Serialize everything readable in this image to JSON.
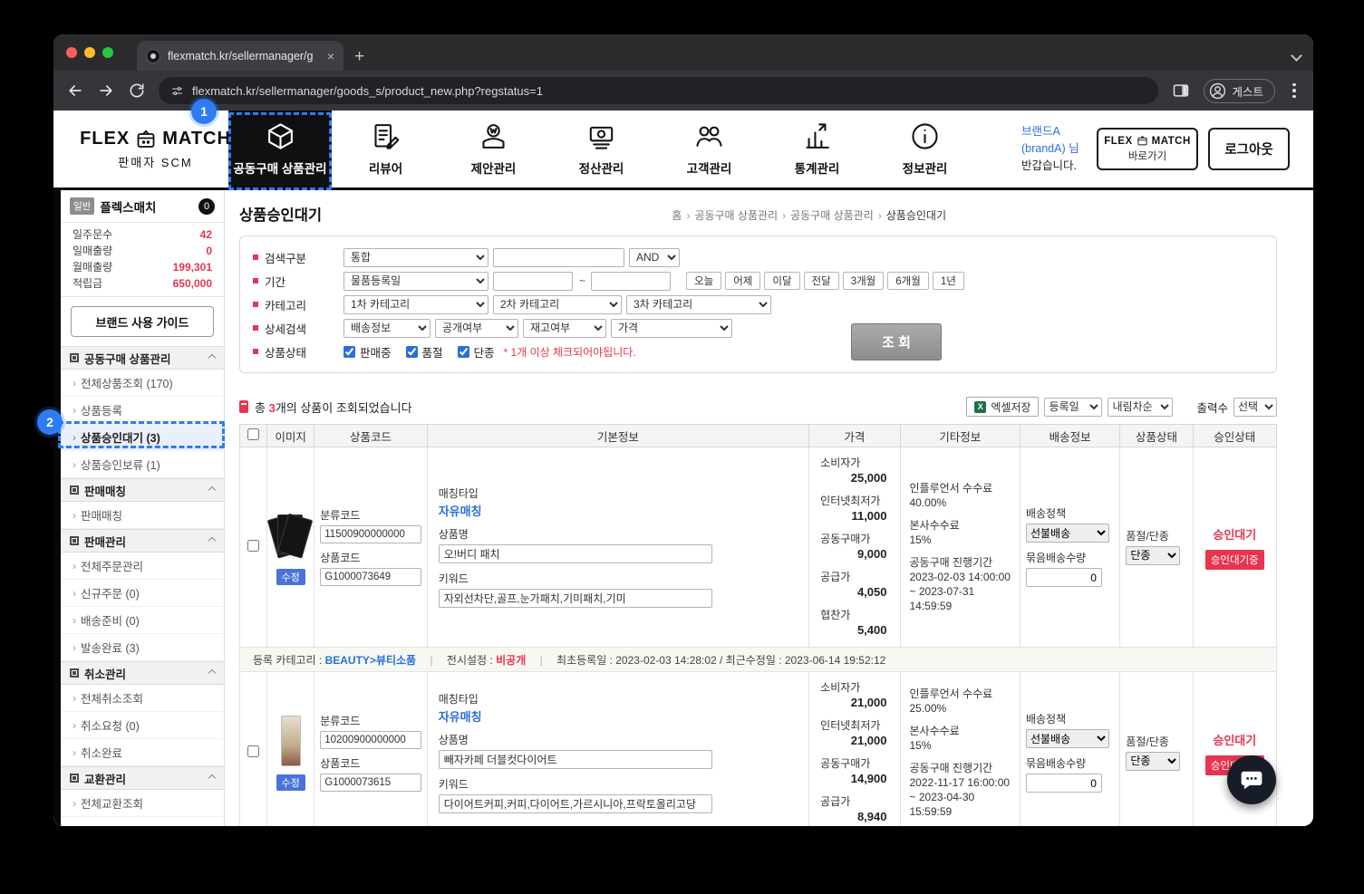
{
  "colors": {
    "accent_blue": "#2e7bf6",
    "danger_red": "#e8354f",
    "link_blue": "#2a6fdb"
  },
  "icons": {
    "close_tab": "×",
    "new_tab": "+"
  },
  "browser": {
    "tab_title": "flexmatch.kr/sellermanager/g",
    "url": "flexmatch.kr/sellermanager/goods_s/product_new.php?regstatus=1",
    "profile_label": "게스트"
  },
  "header": {
    "logo_flex": "FLEX",
    "logo_match": "MATCH",
    "logo_sub": "판매자 SCM",
    "nav": [
      {
        "label": "공동구매 상품관리"
      },
      {
        "label": "리뷰어"
      },
      {
        "label": "제안관리"
      },
      {
        "label": "정산관리"
      },
      {
        "label": "고객관리"
      },
      {
        "label": "통계관리"
      },
      {
        "label": "정보관리"
      }
    ],
    "welcome_brand": "브랜드A",
    "welcome_account": "(brandA) 님",
    "welcome_greeting": "반갑습니다.",
    "shortcut_flex": "FLEX",
    "shortcut_match": "MATCH",
    "shortcut_sub": "바로가기",
    "logout": "로그아웃"
  },
  "callouts": {
    "step1": "1",
    "step2": "2"
  },
  "sidebar": {
    "plan_badge": "일반",
    "brand_name": "플렉스매치",
    "alert_count": "0",
    "stats": [
      {
        "label": "일주문수",
        "value": "42"
      },
      {
        "label": "일매출량",
        "value": "0"
      },
      {
        "label": "월매출량",
        "value": "199,301"
      },
      {
        "label": "적립금",
        "value": "650,000"
      }
    ],
    "guide_button": "브랜드 사용 가이드",
    "sections": [
      {
        "title": "공동구매 상품관리",
        "items": [
          {
            "label": "전체상품조회 (170)"
          },
          {
            "label": "상품등록"
          },
          {
            "label": "상품승인대기 (3)"
          },
          {
            "label": "상품승인보류 (1)"
          }
        ]
      },
      {
        "title": "판매매칭",
        "items": [
          {
            "label": "판매매칭"
          }
        ]
      },
      {
        "title": "판매관리",
        "items": [
          {
            "label": "전체주문관리"
          },
          {
            "label": "신규주문 (0)"
          },
          {
            "label": "배송준비 (0)"
          },
          {
            "label": "발송완료 (3)"
          }
        ]
      },
      {
        "title": "취소관리",
        "items": [
          {
            "label": "전체취소조회"
          },
          {
            "label": "취소요청 (0)"
          },
          {
            "label": "취소완료"
          }
        ]
      },
      {
        "title": "교환관리",
        "items": [
          {
            "label": "전체교환조회"
          }
        ]
      }
    ]
  },
  "main": {
    "page_title": "상품승인대기",
    "breadcrumb": {
      "sep": "›",
      "items": [
        "홈",
        "공동구매 상품관리",
        "공동구매 상품관리",
        "상품승인대기"
      ]
    },
    "search": {
      "label_type": "검색구분",
      "type_select": "통합",
      "and_select": "AND",
      "label_period": "기간",
      "period_select": "물품등록일",
      "tilde": "~",
      "period_buttons": [
        "오늘",
        "어제",
        "이달",
        "전달",
        "3개월",
        "6개월",
        "1년"
      ],
      "label_category": "카테고리",
      "category_selects": [
        "1차 카테고리",
        "2차 카테고리",
        "3차 카테고리"
      ],
      "label_detail": "상세검색",
      "detail_selects": [
        "배송정보",
        "공개여부",
        "재고여부",
        "가격"
      ],
      "label_status": "상품상태",
      "status_checks": [
        "판매중",
        "품절",
        "단종"
      ],
      "status_note": "* 1개 이상 체크되어야됩니다.",
      "submit": "조 회"
    },
    "results": {
      "total_prefix": "총 ",
      "total_count": "3",
      "total_suffix": "개의 상품이 조회되었습니다",
      "excel_button": "엑셀저장",
      "excel_icon_glyph": "X",
      "sort_field": "등록일",
      "sort_order": "내림차순",
      "output_label": "출력수",
      "output_select": "선택"
    },
    "table": {
      "headers": [
        "이미지",
        "상품코드",
        "기본정보",
        "가격",
        "기타정보",
        "배송정보",
        "상품상태",
        "승인상태"
      ],
      "rows": [
        {
          "class_code_label": "분류코드",
          "class_code": "11500900000000",
          "product_code_label": "상품코드",
          "product_code": "G1000073649",
          "edit": "수정",
          "matching_label": "매칭타입",
          "matching": "자유매칭",
          "name_label": "상품명",
          "name": "오!버디 패치",
          "keyword_label": "키워드",
          "keywords": "자외선차단,골프,눈가패치,기미패치,기미",
          "prices": [
            {
              "label": "소비자가",
              "value": "25,000"
            },
            {
              "label": "인터넷최저가",
              "value": "11,000"
            },
            {
              "label": "공동구매가",
              "value": "9,000"
            },
            {
              "label": "공급가",
              "value": "4,050"
            },
            {
              "label": "협찬가",
              "value": "5,400"
            }
          ],
          "fee1_label": "인플루언서 수수료",
          "fee1": "40.00%",
          "fee2_label": "본사수수료",
          "fee2": "15%",
          "period_label": "공동구매 진행기간",
          "period_start": "2023-02-03 14:00:00",
          "period_end": "~ 2023-07-31 14:59:59",
          "ship_policy_label": "배송정책",
          "ship_policy": "선불배송",
          "bundle_label": "묶음배송수량",
          "bundle_qty": "0",
          "state_label": "품절/단종",
          "state": "단종",
          "approval_link": "승인대기",
          "approval_badge": "승인대기중",
          "meta_category_label": "등록 카테고리 :",
          "meta_category": "BEAUTY>뷰티소품",
          "meta_sep": "|",
          "meta_display_label": "전시설정 :",
          "meta_display": "비공개",
          "meta_dates": "최초등록일 : 2023-02-03 14:28:02 / 최근수정일 : 2023-06-14 19:52:12"
        },
        {
          "class_code_label": "분류코드",
          "class_code": "10200900000000",
          "product_code_label": "상품코드",
          "product_code": "G1000073615",
          "edit": "수정",
          "matching_label": "매칭타입",
          "matching": "자유매칭",
          "name_label": "상품명",
          "name": "빼자카페 더블컷다이어트",
          "keyword_label": "키워드",
          "keywords": "다이어트커피,커피,다이어트,가르시니아,프락토올리고당",
          "prices": [
            {
              "label": "소비자가",
              "value": "21,000"
            },
            {
              "label": "인터넷최저가",
              "value": "21,000"
            },
            {
              "label": "공동구매가",
              "value": "14,900"
            },
            {
              "label": "공급가",
              "value": "8,940"
            }
          ],
          "fee1_label": "인플루언서 수수료",
          "fee1": "25.00%",
          "fee2_label": "본사수수료",
          "fee2": "15%",
          "period_label": "공동구매 진행기간",
          "period_start": "2022-11-17 16:00:00",
          "period_end": "~ 2023-04-30 15:59:59",
          "ship_policy_label": "배송정책",
          "ship_policy": "선불배송",
          "bundle_label": "묶음배송수량",
          "bundle_qty": "0",
          "state_label": "품절/단종",
          "state": "단종",
          "approval_link": "승인대기",
          "approval_badge": "승인대기중"
        }
      ]
    }
  }
}
